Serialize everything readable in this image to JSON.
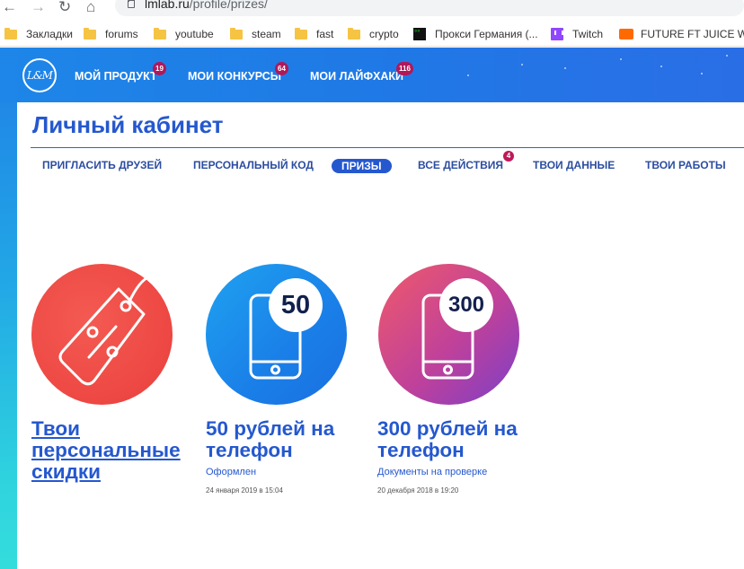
{
  "browser": {
    "url_host": "lmlab.ru",
    "url_path": "/profile/prizes/",
    "bookmarks": [
      {
        "label": "Закладки",
        "icon": "folder-icon"
      },
      {
        "label": "forums",
        "icon": "folder-icon"
      },
      {
        "label": "youtube",
        "icon": "folder-icon"
      },
      {
        "label": "steam",
        "icon": "folder-icon"
      },
      {
        "label": "fast",
        "icon": "folder-icon"
      },
      {
        "label": "crypto",
        "icon": "folder-icon"
      },
      {
        "label": "Прокси Германия (...",
        "icon": "proxy-favicon-icon"
      },
      {
        "label": "Twitch",
        "icon": "twitch-icon"
      },
      {
        "label": "FUTURE FT JUICE W...",
        "icon": "soundcloud-icon"
      }
    ]
  },
  "site": {
    "logo_text": "L&M",
    "top_nav": [
      {
        "label": "МОЙ ПРОДУКТ",
        "badge": "19"
      },
      {
        "label": "МОИ КОНКУРСЫ",
        "badge": "64"
      },
      {
        "label": "МОИ ЛАЙФХАКИ",
        "badge": "116"
      }
    ]
  },
  "page": {
    "title": "Личный кабинет",
    "tabs": [
      {
        "label": "ПРИГЛАСИТЬ ДРУЗЕЙ"
      },
      {
        "label": "ПЕРСОНАЛЬНЫЙ КОД"
      },
      {
        "label": "ПРИЗЫ",
        "active": true
      },
      {
        "label": "ВСЕ ДЕЙСТВИЯ",
        "badge": "4"
      },
      {
        "label": "ТВОИ ДАННЫЕ"
      },
      {
        "label": "ТВОИ РАБОТЫ"
      }
    ]
  },
  "prizes": [
    {
      "title_lines": [
        "Твои",
        "персональные",
        "скидки"
      ],
      "icon": "discount-tag-icon"
    },
    {
      "amount": "50",
      "title_lines": [
        "50 рублей на",
        "телефон"
      ],
      "status": "Оформлен",
      "date": "24 января 2019 в 15:04",
      "icon": "phone-icon"
    },
    {
      "amount": "300",
      "title_lines": [
        "300 рублей на",
        "телефон"
      ],
      "status": "Документы на проверке",
      "date": "20 декабря 2018 в 19:20",
      "icon": "phone-icon"
    }
  ],
  "colors": {
    "brand_blue": "#2558cf",
    "badge": "#b0185a",
    "header_blue": "#1f79e6",
    "discount_red": "#ef4a45"
  }
}
